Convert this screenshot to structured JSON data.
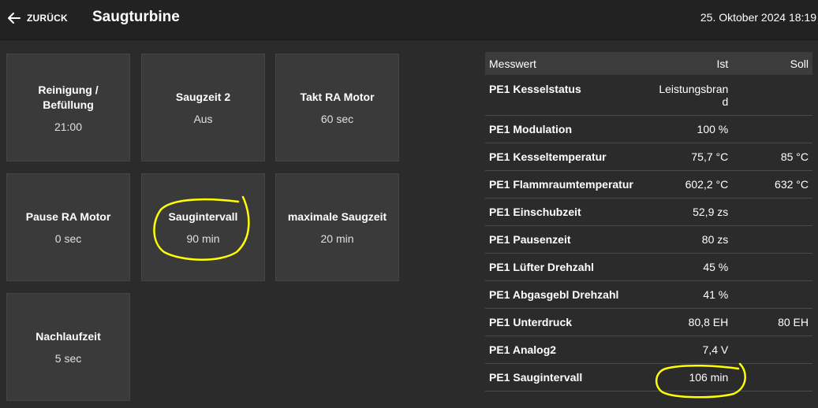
{
  "header": {
    "back_label": "ZURÜCK",
    "title": "Saugturbine",
    "datetime": "25. Oktober 2024 18:19"
  },
  "tiles": [
    {
      "label": "Reinigung / Befüllung",
      "value": "21:00"
    },
    {
      "label": "Saugzeit 2",
      "value": "Aus"
    },
    {
      "label": "Takt RA Motor",
      "value": "60 sec"
    },
    {
      "label": "Pause RA Motor",
      "value": "0 sec"
    },
    {
      "label": "Saugintervall",
      "value": "90 min"
    },
    {
      "label": "maximale Saugzeit",
      "value": "20 min"
    },
    {
      "label": "Nachlaufzeit",
      "value": "5 sec"
    }
  ],
  "table": {
    "headers": {
      "name": "Messwert",
      "ist": "Ist",
      "soll": "Soll"
    },
    "rows": [
      {
        "name": "PE1 Kesselstatus",
        "ist": "Leistungsbrand",
        "soll": ""
      },
      {
        "name": "PE1 Modulation",
        "ist": "100 %",
        "soll": ""
      },
      {
        "name": "PE1 Kesseltemperatur",
        "ist": "75,7 °C",
        "soll": "85 °C"
      },
      {
        "name": "PE1 Flammraumtemperatur",
        "ist": "602,2 °C",
        "soll": "632 °C"
      },
      {
        "name": "PE1 Einschubzeit",
        "ist": "52,9 zs",
        "soll": ""
      },
      {
        "name": "PE1 Pausenzeit",
        "ist": "80 zs",
        "soll": ""
      },
      {
        "name": "PE1 Lüfter Drehzahl",
        "ist": "45 %",
        "soll": ""
      },
      {
        "name": "PE1 Abgasgebl Drehzahl",
        "ist": "41 %",
        "soll": ""
      },
      {
        "name": "PE1 Unterdruck",
        "ist": "80,8 EH",
        "soll": "80 EH"
      },
      {
        "name": "PE1 Analog2",
        "ist": "7,4 V",
        "soll": ""
      },
      {
        "name": "PE1 Saugintervall",
        "ist": "106 min",
        "soll": ""
      }
    ]
  },
  "colors": {
    "background": "#2b2b2b",
    "tile": "#3a3a3a",
    "annotation": "#ffff00"
  },
  "icons": {
    "back": "arrow-left-icon"
  }
}
